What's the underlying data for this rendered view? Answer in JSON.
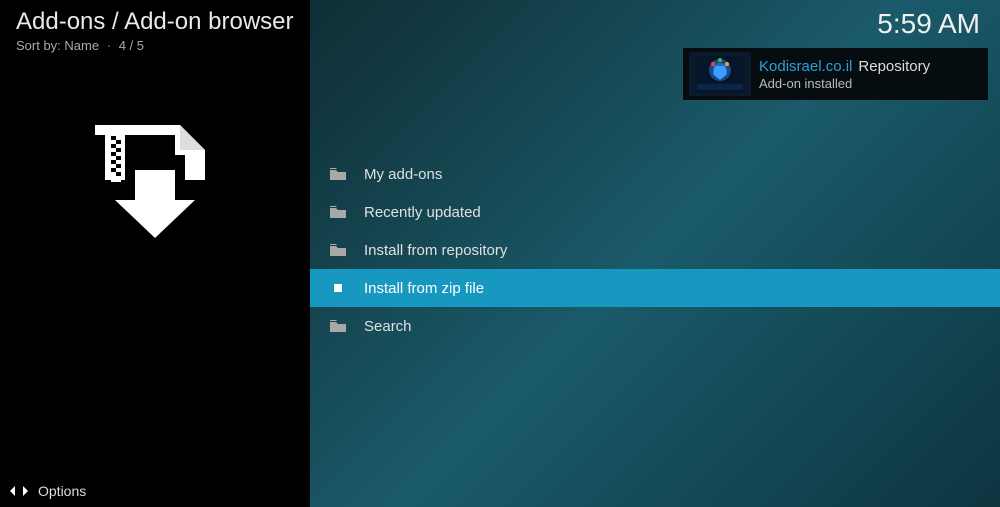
{
  "header": {
    "breadcrumb": "Add-ons / Add-on browser",
    "sort_label": "Sort by:",
    "sort_value": "Name",
    "position": "4 / 5"
  },
  "clock": "5:59 AM",
  "notification": {
    "name": "Kodisrael.co.il",
    "type": "Repository",
    "message": "Add-on installed"
  },
  "menu": {
    "items": [
      {
        "label": "My add-ons",
        "selected": false
      },
      {
        "label": "Recently updated",
        "selected": false
      },
      {
        "label": "Install from repository",
        "selected": false
      },
      {
        "label": "Install from zip file",
        "selected": true
      },
      {
        "label": "Search",
        "selected": false
      }
    ]
  },
  "footer": {
    "options_label": "Options"
  }
}
